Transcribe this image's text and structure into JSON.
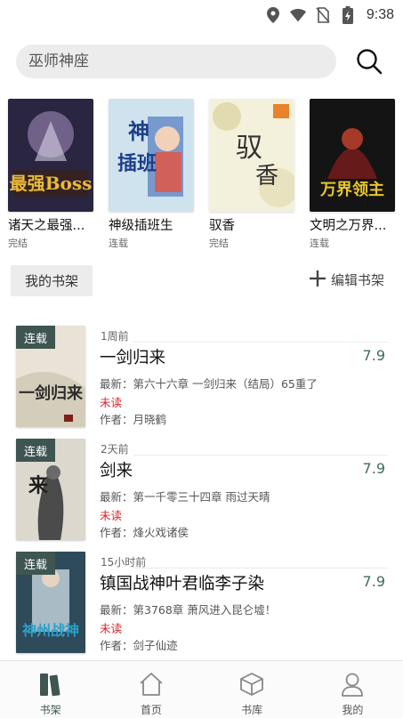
{
  "status": {
    "time": "9:38"
  },
  "search": {
    "placeholder": "巫师神座"
  },
  "recommended": [
    {
      "title": "诸天之最强...",
      "status": "完结",
      "colors": [
        "#2a2540",
        "#8e7aa6",
        "#e9b93a"
      ]
    },
    {
      "title": "神级插班生",
      "status": "连载",
      "colors": [
        "#cfe3ef",
        "#2d5fb3",
        "#e8a33b"
      ]
    },
    {
      "title": "驭香",
      "status": "完结",
      "colors": [
        "#f3f0dc",
        "#dcd6a4",
        "#9b2b2b"
      ]
    },
    {
      "title": "文明之万界...",
      "status": "连载",
      "colors": [
        "#141414",
        "#7a1b1b",
        "#e8c62a"
      ]
    }
  ],
  "shelf": {
    "tab_label": "我的书架",
    "edit_label": "编辑书架"
  },
  "books": [
    {
      "badge": "连载",
      "time": "1周前",
      "title": "一剑归来",
      "score": "7.9",
      "latest": "最新：第六十六章 一剑归来（结局）65重了",
      "unread": "未读",
      "author": "作者：月晓鹤",
      "cover_colors": [
        "#e8e3d6",
        "#7f1f18",
        "#2b2b2b"
      ]
    },
    {
      "badge": "连载",
      "time": "2天前",
      "title": "剑来",
      "score": "7.9",
      "latest": "最新：第一千零三十四章 雨过天晴",
      "unread": "未读",
      "author": "作者：烽火戏诸侯",
      "cover_colors": [
        "#dcd8cd",
        "#4b4b4b",
        "#8b1a1a"
      ]
    },
    {
      "badge": "连载",
      "time": "15小时前",
      "title": "镇国战神叶君临李子染",
      "score": "7.9",
      "latest": "最新：第3768章 萧风进入昆仑墟！",
      "unread": "未读",
      "author": "作者：剑子仙迹",
      "cover_colors": [
        "#2f4a5a",
        "#c8d7df",
        "#2aa0c8"
      ]
    }
  ],
  "nav": [
    {
      "label": "书架",
      "icon": "bookshelf-icon",
      "active": true
    },
    {
      "label": "首页",
      "icon": "home-icon",
      "active": false
    },
    {
      "label": "书库",
      "icon": "cube-icon",
      "active": false
    },
    {
      "label": "我的",
      "icon": "user-icon",
      "active": false
    }
  ],
  "colors": {
    "accent": "#3f5552",
    "unread": "#d9262a",
    "score": "#3f6b5d"
  }
}
